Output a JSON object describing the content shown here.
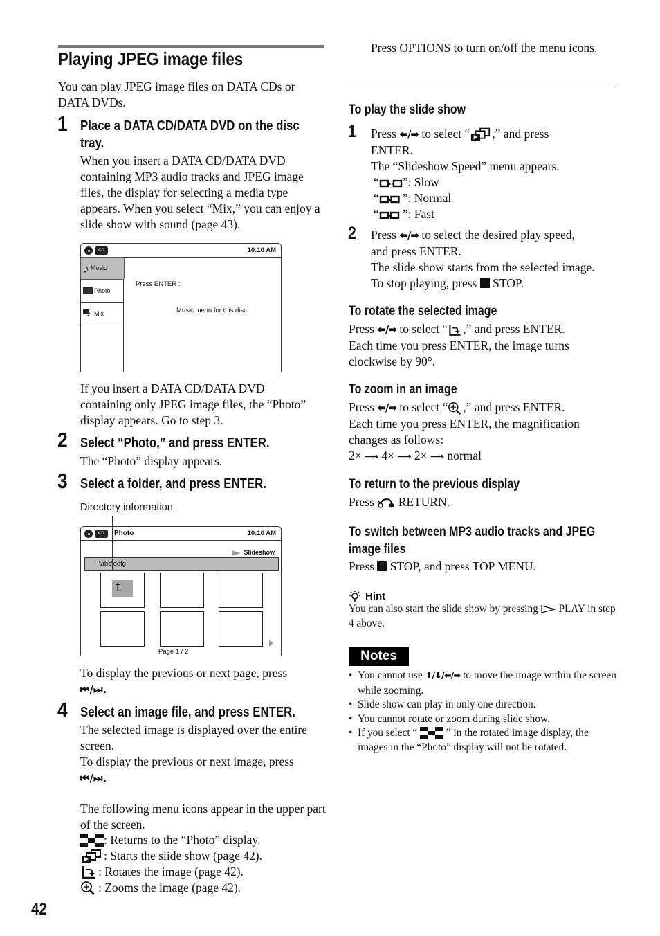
{
  "page": {
    "title": "Playing JPEG image files",
    "page_number": "42"
  },
  "left": {
    "intro": "You can play JPEG image files on DATA CDs or DATA DVDs.",
    "steps": [
      {
        "number": "1",
        "heading": "Place a DATA CD/DATA DVD on the disc tray.",
        "body": "When you insert a DATA CD/DATA DVD containing MP3 audio tracks and JPEG image files, the display for selecting a media type appears. When you select “Mix,” you can enjoy a slide show with sound (page 43).",
        "after": "If you insert a DATA CD/DATA DVD containing only JPEG image files, the “Photo” display appears. Go to step 3."
      },
      {
        "number": "2",
        "heading": "Select “Photo,” and press ENTER.",
        "body": "The “Photo” display appears."
      },
      {
        "number": "3",
        "heading": "Select a folder, and press ENTER.",
        "callout": "Directory information",
        "after": "To display the previous or next page, press",
        "after_keys": "⏮/⏭."
      },
      {
        "number": "4",
        "heading": "Select an image file, and press ENTER.",
        "body": "The selected image is displayed over the entire screen.",
        "body2": "To display the previous or next image, press",
        "body2_keys": "⏮/⏭.",
        "icons_intro": "The following menu icons appear in the upper part of the screen.",
        "icon_list": [
          {
            "icon": "photo-display-grid-icon",
            "text": ": Returns to the “Photo” display."
          },
          {
            "icon": "slideshow-icon",
            "text": " : Starts the slide show (page 42)."
          },
          {
            "icon": "rotate-icon",
            "text": ": Rotates the image (page 42)."
          },
          {
            "icon": "zoom-in-icon",
            "text": ": Zooms the image (page 42)."
          }
        ]
      }
    ]
  },
  "screen1": {
    "disc_label": "CD",
    "time": "10:10 AM",
    "menu": [
      {
        "icon": "music-note-icon",
        "label": "Music",
        "selected": true
      },
      {
        "icon": "photo-icon",
        "label": "Photo",
        "selected": false
      },
      {
        "icon": "mix-icon",
        "label": "Mix",
        "selected": false
      }
    ],
    "prompt": "Press ENTER :",
    "description": "Music menu for this disc."
  },
  "screen2": {
    "disc_label": "CD",
    "title": "Photo",
    "time": "10:10 AM",
    "slideshow_label": "Slideshow",
    "path": "\\abc\\defg",
    "page_indicator": "Page 1 / 2"
  },
  "right": {
    "options_note": "Press OPTIONS to turn on/off the menu icons.",
    "slideshow": {
      "heading": "To play the slide show",
      "step1": {
        "number": "1",
        "line1_pre": "Press",
        "line1_mid": "to select “",
        "line1_post": ",” and press",
        "line2": "ENTER.",
        "line3": "The “Slideshow Speed” menu appears.",
        "speeds": [
          {
            "label": "”: Slow"
          },
          {
            "label": "”: Normal"
          },
          {
            "label": "”: Fast"
          }
        ]
      },
      "step2": {
        "number": "2",
        "line1_pre": "Press",
        "line1_post": "to select the desired play speed,",
        "line2": "and press ENTER.",
        "line3": "The slide show starts from the selected image.",
        "line4_pre": "To stop playing, press",
        "line4_post": "STOP."
      }
    },
    "rotate": {
      "heading": "To rotate the selected image",
      "line1_pre": "Press",
      "line1_mid": "to select “",
      "line1_post": ",” and press ENTER.",
      "line2": "Each time you press ENTER, the image turns clockwise by 90°."
    },
    "zoom": {
      "heading": "To zoom in an image",
      "line1_pre": "Press",
      "line1_mid": "to select “",
      "line1_post": ",” and press ENTER.",
      "line2": "Each time you press ENTER, the magnification changes as follows:",
      "sequence": [
        "2×",
        "4×",
        "2×",
        "normal"
      ]
    },
    "return": {
      "heading": "To return to the previous display",
      "line_pre": "Press",
      "line_post": "RETURN."
    },
    "switch": {
      "heading": "To switch between MP3 audio tracks and JPEG image files",
      "line_pre": "Press",
      "line_post": "STOP, and press TOP MENU."
    },
    "hint": {
      "label": "Hint",
      "text_pre": "You can also start the slide show by pressing",
      "text_post": "PLAY in step 4 above."
    },
    "notes": {
      "label": "Notes",
      "items": [
        {
          "pre": "You cannot use",
          "post": "to move the image within the screen while zooming."
        },
        {
          "pre": "Slide show can play in only one direction.",
          "post": ""
        },
        {
          "pre": "You cannot rotate or zoom during slide show.",
          "post": ""
        },
        {
          "pre": "If you select “",
          "post": "” in the rotated image display, the images in the “Photo” display will not be rotated."
        }
      ]
    }
  }
}
